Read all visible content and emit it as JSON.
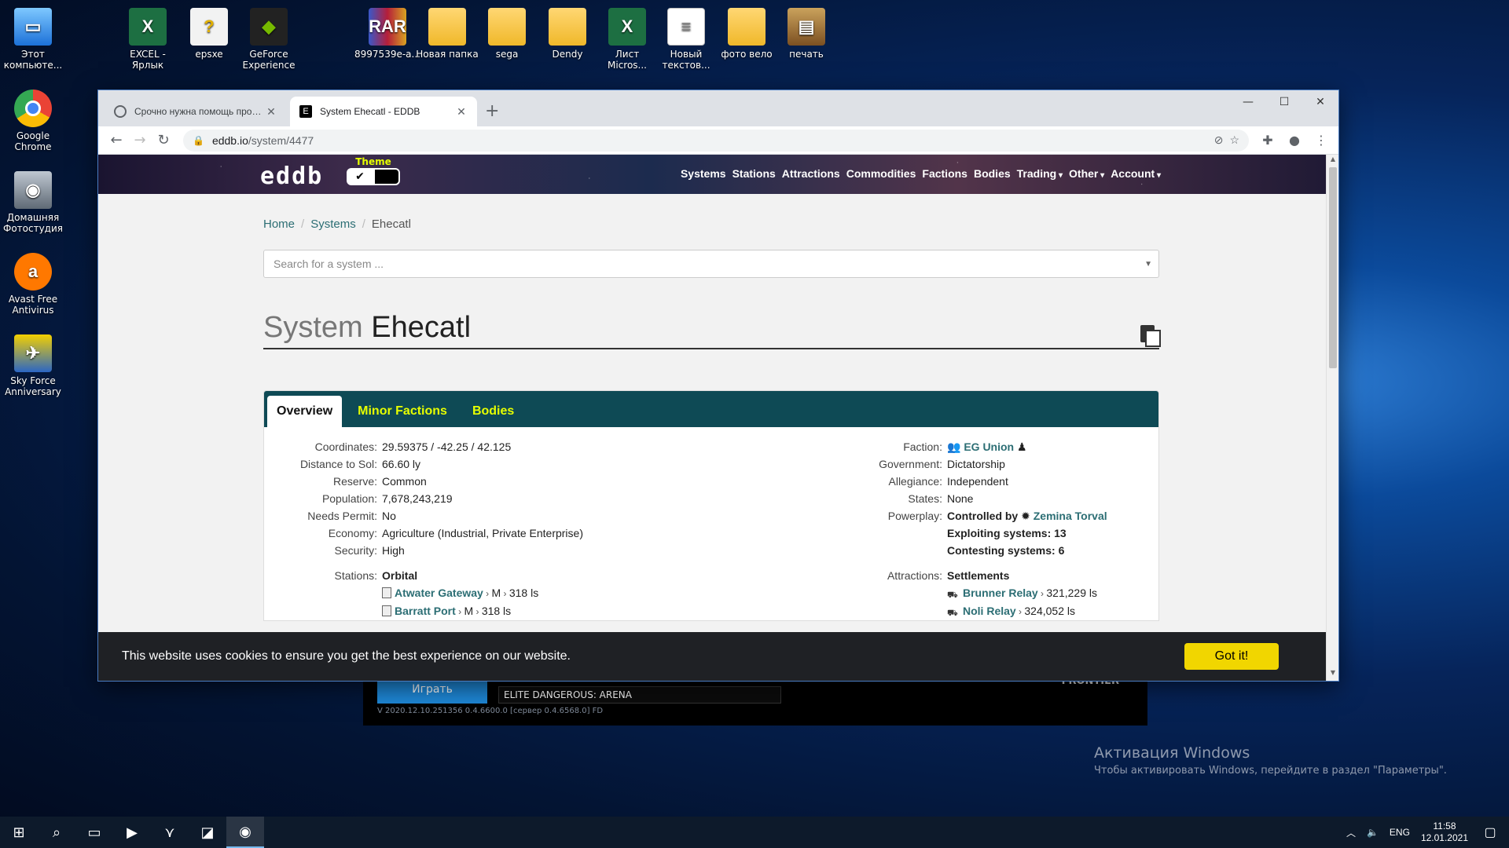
{
  "desktop": {
    "left_icons": [
      {
        "label": "Этот компьюте...",
        "icon": "this-pc-icon"
      },
      {
        "label": "Google Chrome",
        "icon": "chrome-icon"
      },
      {
        "label": "Домашняя Фотостудия",
        "icon": "camera-icon"
      },
      {
        "label": "Avast Free Antivirus",
        "icon": "avast-icon"
      },
      {
        "label": "Sky Force Anniversary",
        "icon": "sky-force-icon"
      }
    ],
    "top_icons": [
      {
        "label": "EXCEL - Ярлык",
        "icon": "excel-icon"
      },
      {
        "label": "epsxe",
        "icon": "epsxe-icon"
      },
      {
        "label": "GeForce Experience",
        "icon": "nvidia-icon"
      },
      {
        "label": "8997539e-a...",
        "icon": "winrar-icon"
      },
      {
        "label": "Новая папка",
        "icon": "folder-icon"
      },
      {
        "label": "sega",
        "icon": "folder-icon"
      },
      {
        "label": "Dendy",
        "icon": "folder-icon"
      },
      {
        "label": "Лист Micros...",
        "icon": "excel-icon"
      },
      {
        "label": "Новый текстов...",
        "icon": "text-file-icon"
      },
      {
        "label": "фото вело",
        "icon": "folder-icon"
      },
      {
        "label": "печать",
        "icon": "print-icon"
      }
    ],
    "activation": {
      "title": "Активация Windows",
      "subtitle": "Чтобы активировать Windows, перейдите в раздел \"Параметры\"."
    },
    "game_window": {
      "play_label": "Играть",
      "selected_game": "ELITE DANGEROUS: ARENA",
      "version": "V 2020.12.10.251356   0.4.6600.0 [сервер 0.4.6568.0] FD",
      "brand": "FRONTIER"
    }
  },
  "browser": {
    "tabs": [
      {
        "title": "Срочно нужна помощь профи...",
        "active": false
      },
      {
        "title": "System Ehecatl - EDDB",
        "active": true
      }
    ],
    "url_host": "eddb.io",
    "url_path": "/system/4477"
  },
  "site": {
    "logo": "eddb",
    "theme_label": "Theme",
    "theme_check": "✔",
    "menu": [
      {
        "label": "Systems",
        "dropdown": false
      },
      {
        "label": "Stations",
        "dropdown": false
      },
      {
        "label": "Attractions",
        "dropdown": false
      },
      {
        "label": "Commodities",
        "dropdown": false
      },
      {
        "label": "Factions",
        "dropdown": false
      },
      {
        "label": "Bodies",
        "dropdown": false
      },
      {
        "label": "Trading",
        "dropdown": true
      },
      {
        "label": "Other",
        "dropdown": true
      },
      {
        "label": "Account",
        "dropdown": true
      }
    ],
    "breadcrumb": [
      "Home",
      "Systems",
      "Ehecatl"
    ],
    "search_placeholder": "Search for a system ...",
    "title_prefix": "System",
    "title_name": "Ehecatl",
    "panel_tabs": [
      "Overview",
      "Minor Factions",
      "Bodies"
    ],
    "overview_left": [
      {
        "k": "Coordinates:",
        "v": "29.59375 / -42.25 / 42.125"
      },
      {
        "k": "Distance to Sol:",
        "v": "66.60 ly"
      },
      {
        "k": "Reserve:",
        "v": "Common"
      },
      {
        "k": "Population:",
        "v": "7,678,243,219"
      },
      {
        "k": "Needs Permit:",
        "v": "No"
      },
      {
        "k": "Economy:",
        "v": "Agriculture (Industrial, Private Enterprise)"
      },
      {
        "k": "Security:",
        "v": "High"
      }
    ],
    "overview_right": [
      {
        "k": "Faction:",
        "v": "EG Union"
      },
      {
        "k": "Government:",
        "v": "Dictatorship"
      },
      {
        "k": "Allegiance:",
        "v": "Independent"
      },
      {
        "k": "States:",
        "v": "None"
      },
      {
        "k": "Powerplay:",
        "v_prefix": "Controlled by",
        "v": "Zemina Torval"
      }
    ],
    "powerplay_extra": [
      "Exploiting systems: 13",
      "Contesting systems: 6"
    ],
    "stations_label": "Stations:",
    "stations_group": "Orbital",
    "stations": [
      {
        "name": "Atwater Gateway",
        "pad": "M",
        "dist": "318 ls"
      },
      {
        "name": "Barratt Port",
        "pad": "M",
        "dist": "318 ls"
      }
    ],
    "attractions_label": "Attractions:",
    "attractions_group": "Settlements",
    "attractions": [
      {
        "name": "Brunner Relay",
        "dist": "321,229 ls"
      },
      {
        "name": "Noli Relay",
        "dist": "324,052 ls"
      }
    ],
    "cookie_text": "This website uses cookies to ensure you get the best experience on our website.",
    "cookie_button": "Got it!"
  },
  "taskbar": {
    "lang": "ENG",
    "time": "11:58",
    "date": "12.01.2021"
  }
}
